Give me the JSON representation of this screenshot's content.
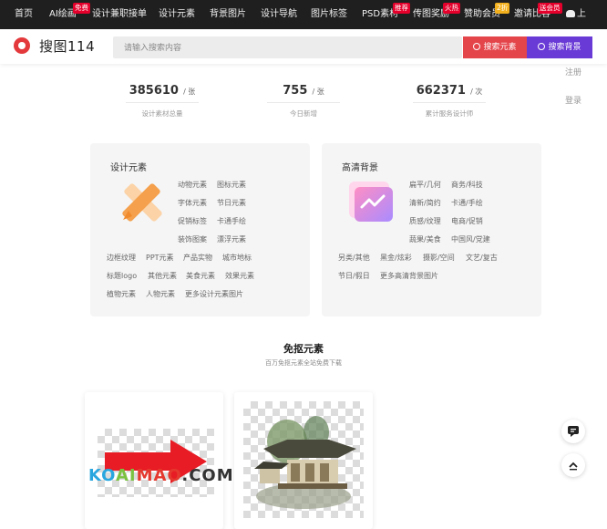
{
  "topnav": {
    "items": [
      "首页",
      "AI绘画",
      "设计兼职接单",
      "设计元素",
      "背景图片",
      "设计导航",
      "图片标签",
      "PSD素材",
      "传图奖励",
      "赞助会员",
      "邀请比客",
      "上"
    ],
    "badges": {
      "ai": "免费",
      "psd": "推荐",
      "reward": "火热",
      "vip": "2折",
      "invite": "送会员"
    }
  },
  "header": {
    "logo_text": "搜图114",
    "search_placeholder": "请输入搜索内容",
    "search_elements_label": "搜索元素",
    "search_backgrounds_label": "搜索背景"
  },
  "side_links": {
    "register": "注册",
    "login": "登录"
  },
  "stats": [
    {
      "value": "385610",
      "unit": "/ 张",
      "label": "设计素材总量"
    },
    {
      "value": "755",
      "unit": "/ 张",
      "label": "今日新增"
    },
    {
      "value": "662371",
      "unit": "/ 次",
      "label": "累计服务设计师"
    }
  ],
  "design_elements": {
    "title": "设计元素",
    "top_tags": [
      [
        "动物元素",
        "图标元素"
      ],
      [
        "字体元素",
        "节日元素"
      ],
      [
        "促销标签",
        "卡通手绘"
      ],
      [
        "装饰图案",
        "漂浮元素"
      ]
    ],
    "rows": [
      [
        "边框纹理",
        "PPT元素",
        "产品实物",
        "城市地标"
      ],
      [
        "标题logo",
        "其他元素",
        "美食元素",
        "效果元素"
      ],
      [
        "植物元素",
        "人物元素",
        "更多设计元素图片"
      ]
    ]
  },
  "hd_backgrounds": {
    "title": "高清背景",
    "top_tags": [
      [
        "扁平/几何",
        "商务/科技"
      ],
      [
        "清新/简约",
        "卡通/手绘"
      ],
      [
        "质感/纹理",
        "电商/促销"
      ],
      [
        "蔬果/美食",
        "中国风/党建"
      ]
    ],
    "rows": [
      [
        "另类/其他",
        "黑金/炫彩",
        "摄影/空间",
        "文艺/复古"
      ],
      [
        "节日/假日",
        "更多高清背景图片"
      ]
    ]
  },
  "free_section": {
    "title": "免抠元素",
    "subtitle": "百万免抠元素全站免费下载"
  },
  "watermark": "KOAIMAO.COM",
  "colors": {
    "topnav_bg": "#1f1f1f",
    "brand_red": "#e4454b",
    "brand_purple": "#6a3ad6",
    "badge_red": "#e4002b",
    "card_bg": "#f5f5f5"
  }
}
